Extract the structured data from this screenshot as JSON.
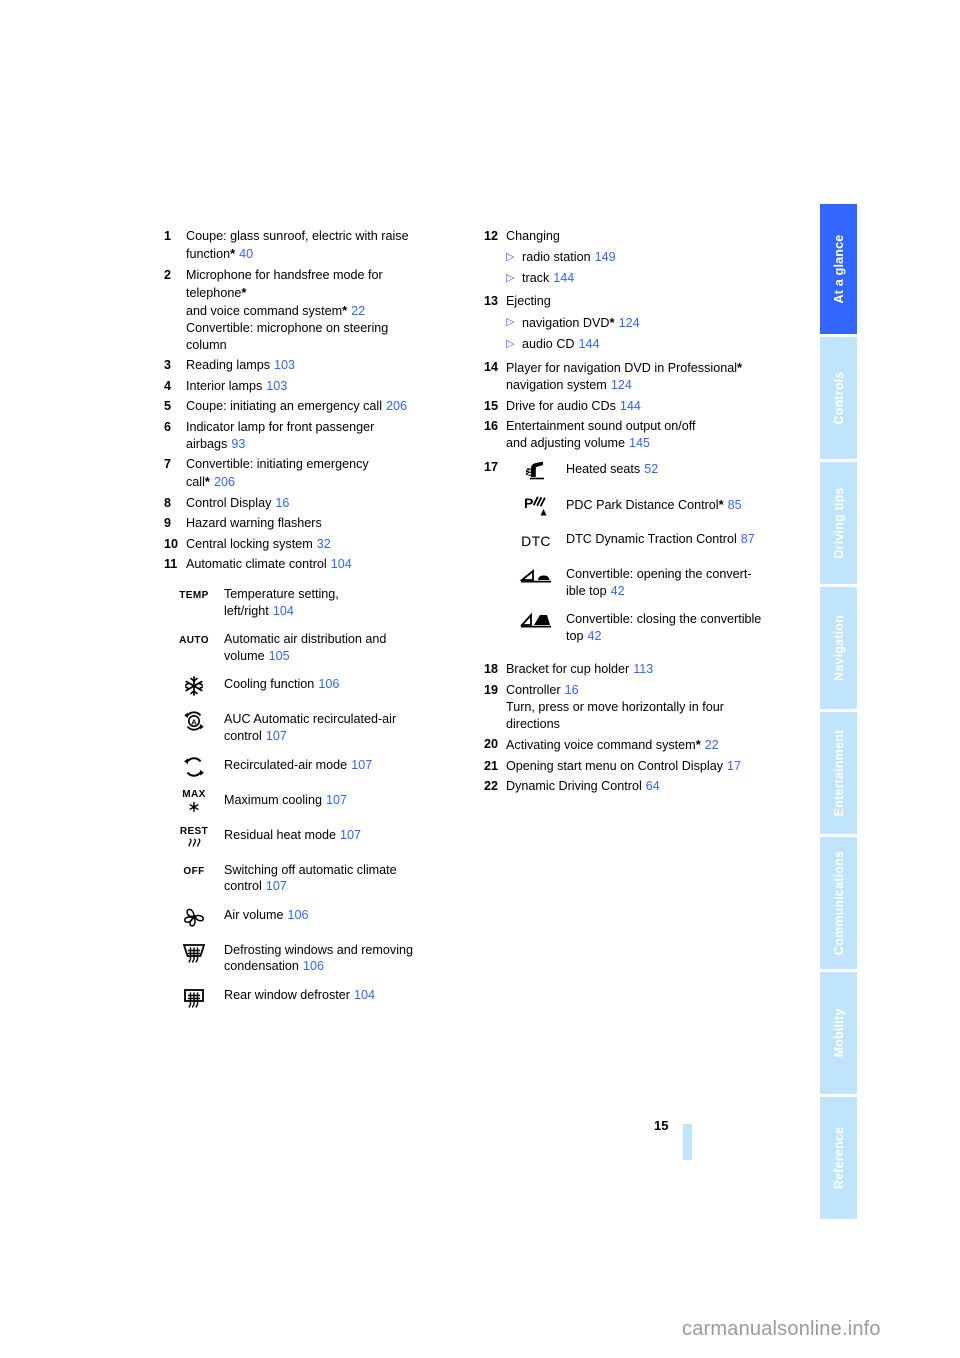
{
  "page": {
    "number": "15",
    "watermark": "carmanualsonline.info"
  },
  "sidebar": {
    "tabs": [
      {
        "label": "At a glance",
        "active": true
      },
      {
        "label": "Controls",
        "active": false
      },
      {
        "label": "Driving tips",
        "active": false
      },
      {
        "label": "Navigation",
        "active": false
      },
      {
        "label": "Entertainment",
        "active": false
      },
      {
        "label": "Communications",
        "active": false
      },
      {
        "label": "Mobility",
        "active": false
      },
      {
        "label": "Reference",
        "active": false
      }
    ],
    "active_color": "#3366ff",
    "inactive_color": "#bfe4fb"
  },
  "colors": {
    "page_ref": "#3366ff",
    "text": "#000000",
    "watermark": "#9a9a9a"
  },
  "left_column": {
    "items": [
      {
        "num": "1",
        "lines": [
          "Coupe: glass sunroof, electric with raise",
          "function"
        ],
        "asterisk": true,
        "page": "40",
        "text": "Coupe: glass sunroof, electric with raise function",
        "text_a": "Coupe: glass sunroof, electric with raise",
        "text_b": "function"
      },
      {
        "num": "2",
        "text_a": "Microphone for handsfree mode for",
        "text_b": "telephone",
        "text_c": "and voice command system",
        "page": "22",
        "text_d": "Convertible: microphone on steering",
        "text_e": "column"
      },
      {
        "num": "3",
        "text": "Reading lamps",
        "page": "103"
      },
      {
        "num": "4",
        "text": "Interior lamps",
        "page": "103"
      },
      {
        "num": "5",
        "text": "Coupe: initiating an emergency call",
        "page": "206"
      },
      {
        "num": "6",
        "text_a": "Indicator lamp for front passenger",
        "text_b": "airbags",
        "page": "93"
      },
      {
        "num": "7",
        "text_a": "Convertible: initiating emergency",
        "text_b": "call",
        "page": "206"
      },
      {
        "num": "8",
        "text": "Control Display",
        "page": "16"
      },
      {
        "num": "9",
        "text": "Hazard warning flashers",
        "page": ""
      },
      {
        "num": "10",
        "text": "Central locking system",
        "page": "32"
      },
      {
        "num": "11",
        "text": "Automatic climate control",
        "page": "104"
      }
    ],
    "climate_icons": [
      {
        "icon": "temp-icon",
        "glyph": "TEMP",
        "glyph_sub": "",
        "text_a": "Temperature setting,",
        "text_b": "left/right",
        "page": "104"
      },
      {
        "icon": "auto-icon",
        "glyph": "AUTO",
        "glyph_sub": "",
        "text_a": "Automatic air distribution and",
        "text_b": "volume",
        "page": "105"
      },
      {
        "icon": "snowflake-icon",
        "glyph": "",
        "glyph_sub": "",
        "text_a": "Cooling function",
        "text_b": "",
        "page": "106"
      },
      {
        "icon": "auc-recirculated-air-icon",
        "glyph": "",
        "glyph_sub": "",
        "text_a": "AUC Automatic recirculated-air",
        "text_b": "control",
        "page": "107"
      },
      {
        "icon": "recirculated-air-icon",
        "glyph": "",
        "glyph_sub": "",
        "text_a": "Recirculated-air mode",
        "text_b": "",
        "page": "107"
      },
      {
        "icon": "max-cooling-icon",
        "glyph": "MAX",
        "glyph_sub": "",
        "text_a": "Maximum cooling",
        "text_b": "",
        "page": "107"
      },
      {
        "icon": "residual-heat-icon",
        "glyph": "REST",
        "glyph_sub": "",
        "text_a": "Residual heat mode",
        "text_b": "",
        "page": "107"
      },
      {
        "icon": "off-icon",
        "glyph": "OFF",
        "glyph_sub": "",
        "text_a": "Switching off automatic climate",
        "text_b": "control",
        "page": "107"
      },
      {
        "icon": "fan-icon",
        "glyph": "",
        "glyph_sub": "",
        "text_a": "Air volume",
        "text_b": "",
        "page": "106"
      },
      {
        "icon": "windshield-defrost-icon",
        "glyph": "",
        "glyph_sub": "",
        "text_a": "Defrosting windows and removing",
        "text_b": "condensation",
        "page": "106"
      },
      {
        "icon": "rear-window-defroster-icon",
        "glyph": "",
        "glyph_sub": "",
        "text_a": "Rear window defroster",
        "text_b": "",
        "page": "104"
      }
    ]
  },
  "right_column": {
    "items": [
      {
        "num": "12",
        "text": "Changing",
        "subs": [
          {
            "text": "radio station",
            "page": "149"
          },
          {
            "text": "track",
            "page": "144"
          }
        ]
      },
      {
        "num": "13",
        "text": "Ejecting",
        "subs": [
          {
            "text": "navigation DVD",
            "asterisk": true,
            "page": "124"
          },
          {
            "text": "audio CD",
            "asterisk": false,
            "page": "144"
          }
        ]
      },
      {
        "num": "14",
        "text_a": "Player for navigation DVD in Professional",
        "text_b": "navigation system",
        "page": "124"
      },
      {
        "num": "15",
        "text": "Drive for audio CDs",
        "page": "144"
      },
      {
        "num": "16",
        "text_a": "Entertainment sound output on/off",
        "text_b": "and adjusting volume",
        "page": "145"
      }
    ],
    "group17": {
      "num": "17",
      "icons": [
        {
          "icon": "heated-seat-icon",
          "glyph": "",
          "text_a": "Heated seats",
          "text_b": "",
          "page": "52"
        },
        {
          "icon": "pdc-icon",
          "glyph": "",
          "text_a": "PDC Park Distance Control",
          "asterisk": true,
          "text_b": "",
          "page": "85"
        },
        {
          "icon": "dtc-icon",
          "glyph": "DTC",
          "text_a": "DTC Dynamic Traction Control",
          "text_b": "",
          "page": "87"
        },
        {
          "icon": "convertible-top-open-icon",
          "glyph": "",
          "text_a": "Convertible: opening the convert-",
          "text_b": "ible top",
          "page": "42"
        },
        {
          "icon": "convertible-top-close-icon",
          "glyph": "",
          "text_a": "Convertible: closing the convertible",
          "text_b": "top",
          "page": "42"
        }
      ]
    },
    "items_tail": [
      {
        "num": "18",
        "text": "Bracket for cup holder",
        "page": "113"
      },
      {
        "num": "19",
        "text": "Controller",
        "page": "16",
        "text_b": "Turn, press or move horizontally in four",
        "text_c": "directions"
      },
      {
        "num": "20",
        "text": "Activating voice command system",
        "asterisk": true,
        "page": "22"
      },
      {
        "num": "21",
        "text": "Opening start menu on Control Display",
        "page": "17"
      },
      {
        "num": "22",
        "text": "Dynamic Driving Control",
        "page": "64"
      }
    ]
  }
}
